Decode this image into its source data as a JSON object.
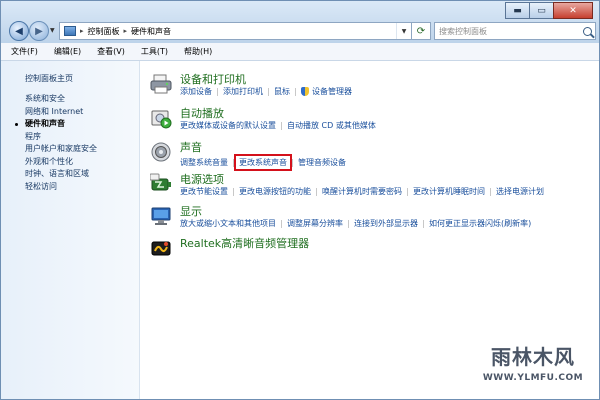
{
  "window": {
    "controls": {
      "minimize": "▬",
      "maximize": "▭",
      "close": "✕"
    }
  },
  "address": {
    "crumbs": [
      "控制面板",
      "硬件和声音"
    ],
    "separator": "▸"
  },
  "search": {
    "placeholder": "搜索控制面板"
  },
  "menu": [
    "文件(F)",
    "编辑(E)",
    "查看(V)",
    "工具(T)",
    "帮助(H)"
  ],
  "sidebar": {
    "home": "控制面板主页",
    "items": [
      {
        "label": "系统和安全",
        "active": false
      },
      {
        "label": "网络和 Internet",
        "active": false
      },
      {
        "label": "硬件和声音",
        "active": true
      },
      {
        "label": "程序",
        "active": false
      },
      {
        "label": "用户帐户和家庭安全",
        "active": false
      },
      {
        "label": "外观和个性化",
        "active": false
      },
      {
        "label": "时钟、语言和区域",
        "active": false
      },
      {
        "label": "轻松访问",
        "active": false
      }
    ]
  },
  "sections": [
    {
      "title": "设备和打印机",
      "icon": "printer-icon",
      "links": [
        "添加设备",
        "添加打印机",
        "鼠标",
        "设备管理器"
      ]
    },
    {
      "title": "自动播放",
      "icon": "autoplay-icon",
      "links": [
        "更改媒体或设备的默认设置",
        "自动播放 CD 或其他媒体"
      ]
    },
    {
      "title": "声音",
      "icon": "speaker-icon",
      "links": [
        "调整系统音量",
        "更改系统声音",
        "管理音频设备"
      ],
      "highlighted": "更改系统声音"
    },
    {
      "title": "电源选项",
      "icon": "power-icon",
      "links": [
        "更改节能设置",
        "更改电源按钮的功能",
        "唤醒计算机时需要密码",
        "更改计算机睡眠时间",
        "选择电源计划"
      ]
    },
    {
      "title": "显示",
      "icon": "display-icon",
      "links": [
        "放大或缩小文本和其他项目",
        "调整屏幕分辨率",
        "连接到外部显示器",
        "如何更正显示器闪烁(刷新率)"
      ]
    },
    {
      "title": "Realtek高清晰音频管理器",
      "icon": "realtek-icon",
      "links": []
    }
  ],
  "watermark": {
    "name": "雨林木风",
    "url": "WWW.YLMFU.COM"
  },
  "colors": {
    "section_title": "#1f6e1f",
    "link": "#1a4f9c",
    "highlight_border": "#d4111b"
  }
}
